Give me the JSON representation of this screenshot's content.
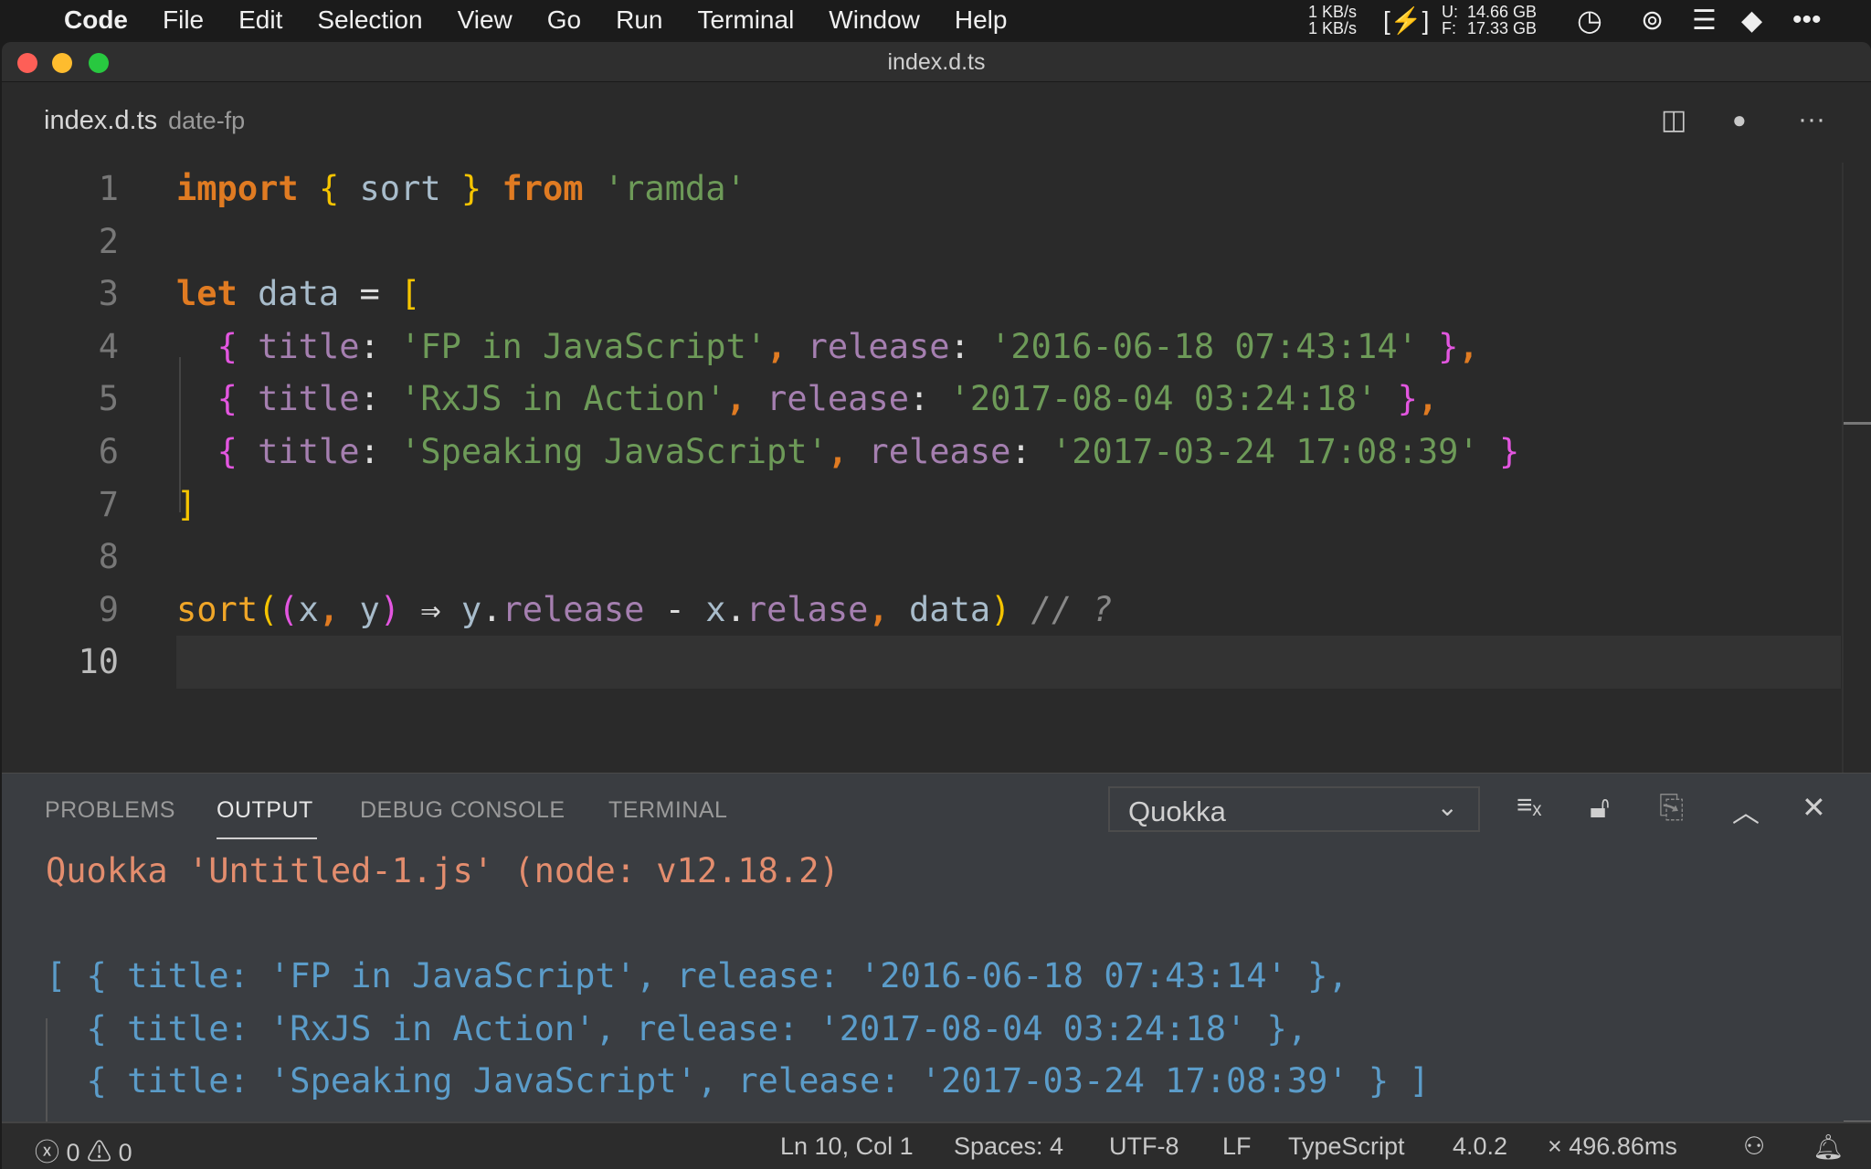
{
  "menubar": {
    "app": "Code",
    "items": [
      "File",
      "Edit",
      "Selection",
      "View",
      "Go",
      "Run",
      "Terminal",
      "Window",
      "Help"
    ],
    "net_up": "1 KB/s",
    "net_down": "1 KB/s",
    "disk_used_label": "U:",
    "disk_used": "14.66 GB",
    "disk_free_label": "F:",
    "disk_free": "17.33 GB"
  },
  "window": {
    "title": "index.d.ts"
  },
  "editor": {
    "filename": "index.d.ts",
    "folder": "date-fp",
    "current_line": 10,
    "lines": [
      [
        [
          "import",
          "kw"
        ],
        [
          " ",
          ""
        ],
        [
          "{",
          "yb"
        ],
        [
          " sort ",
          "id"
        ],
        [
          "}",
          "yb"
        ],
        [
          " ",
          ""
        ],
        [
          "from",
          "kw"
        ],
        [
          " 'ramda'",
          "str"
        ]
      ],
      [],
      [
        [
          "let",
          "kw"
        ],
        [
          " data ",
          "id"
        ],
        [
          "=",
          "op"
        ],
        [
          " ",
          ""
        ],
        [
          "[",
          "yb"
        ]
      ],
      [
        [
          "  ",
          ""
        ],
        [
          "{",
          "pk"
        ],
        [
          " title",
          "pr"
        ],
        [
          ": ",
          "op"
        ],
        [
          "'FP in JavaScript'",
          "str"
        ],
        [
          ", ",
          "kw"
        ],
        [
          "release",
          "pr"
        ],
        [
          ": ",
          "op"
        ],
        [
          "'2016-06-18 07:43:14'",
          "str"
        ],
        [
          " ",
          ""
        ],
        [
          "}",
          "pk"
        ],
        [
          ",",
          "kw"
        ]
      ],
      [
        [
          "  ",
          ""
        ],
        [
          "{",
          "pk"
        ],
        [
          " title",
          "pr"
        ],
        [
          ": ",
          "op"
        ],
        [
          "'RxJS in Action'",
          "str"
        ],
        [
          ", ",
          "kw"
        ],
        [
          "release",
          "pr"
        ],
        [
          ": ",
          "op"
        ],
        [
          "'2017-08-04 03:24:18'",
          "str"
        ],
        [
          " ",
          ""
        ],
        [
          "}",
          "pk"
        ],
        [
          ",",
          "kw"
        ]
      ],
      [
        [
          "  ",
          ""
        ],
        [
          "{",
          "pk"
        ],
        [
          " title",
          "pr"
        ],
        [
          ": ",
          "op"
        ],
        [
          "'Speaking JavaScript'",
          "str"
        ],
        [
          ", ",
          "kw"
        ],
        [
          "release",
          "pr"
        ],
        [
          ": ",
          "op"
        ],
        [
          "'2017-03-24 17:08:39'",
          "str"
        ],
        [
          " ",
          ""
        ],
        [
          "}",
          "pk"
        ]
      ],
      [
        [
          "]",
          "yb"
        ]
      ],
      [],
      [
        [
          "sort",
          "fn"
        ],
        [
          "(",
          "yb"
        ],
        [
          "(",
          "pk"
        ],
        [
          "x",
          "id"
        ],
        [
          ", ",
          "kw"
        ],
        [
          "y",
          "id"
        ],
        [
          ")",
          "pk"
        ],
        [
          " ⇒ ",
          "op"
        ],
        [
          "y",
          "id"
        ],
        [
          ".",
          "op"
        ],
        [
          "release",
          "pr"
        ],
        [
          " - ",
          "op"
        ],
        [
          "x",
          "id"
        ],
        [
          ".",
          "op"
        ],
        [
          "relase",
          "pr"
        ],
        [
          ", ",
          "kw"
        ],
        [
          "data",
          "id"
        ],
        [
          ")",
          "yb"
        ],
        [
          " // ?",
          "cm"
        ]
      ],
      []
    ]
  },
  "panel": {
    "tabs": [
      "PROBLEMS",
      "OUTPUT",
      "DEBUG CONSOLE",
      "TERMINAL"
    ],
    "active_tab": "OUTPUT",
    "output_channel": "Quokka",
    "output": [
      "Quokka 'Untitled-1.js' (node: v12.18.2)",
      "",
      "[ { title: 'FP in JavaScript', release: '2016-06-18 07:43:14' },",
      "  { title: 'RxJS in Action', release: '2017-08-04 03:24:18' },",
      "  { title: 'Speaking JavaScript', release: '2017-03-24 17:08:39' } ]"
    ]
  },
  "status": {
    "errors": "0",
    "warnings": "0",
    "position": "Ln 10, Col 1",
    "spaces": "Spaces: 4",
    "encoding": "UTF-8",
    "eol": "LF",
    "language": "TypeScript",
    "version": "4.0.2",
    "timing": "× 496.86ms"
  }
}
